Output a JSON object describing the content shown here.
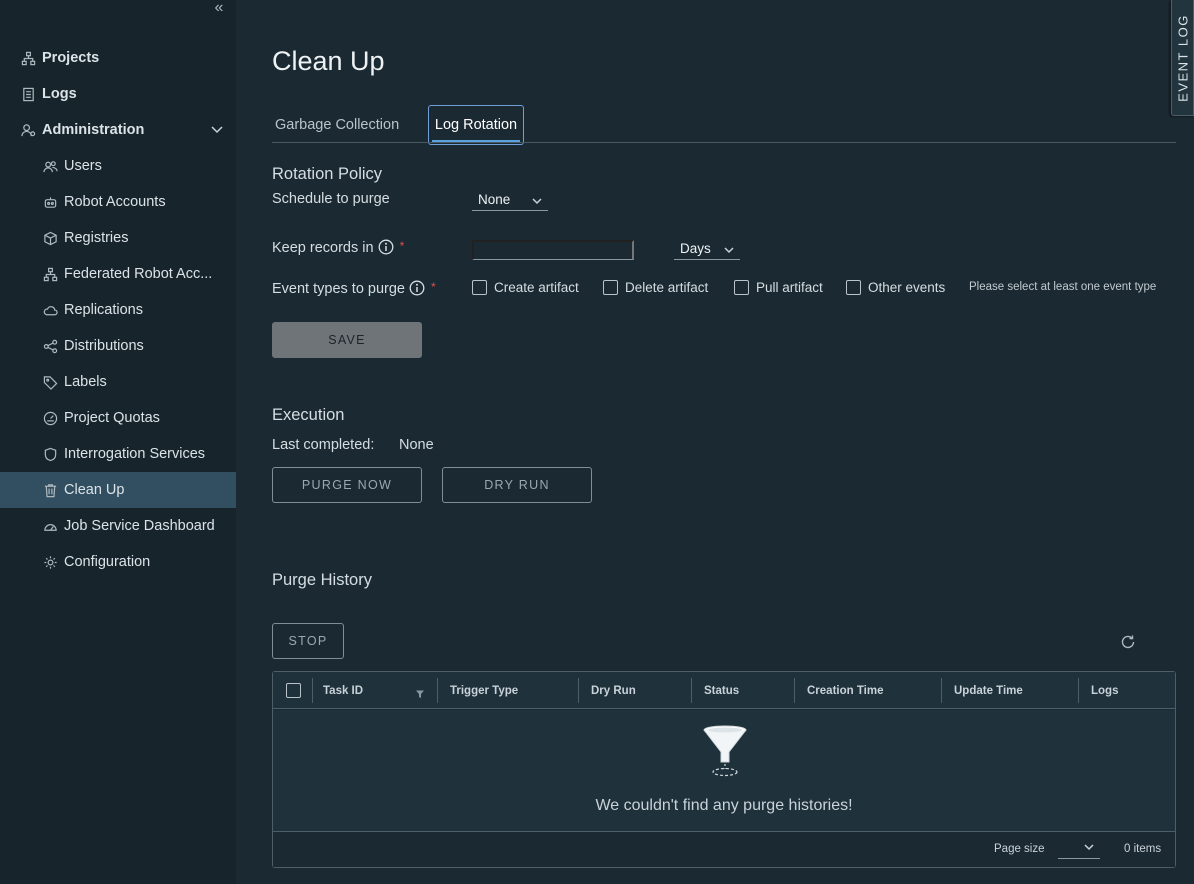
{
  "sidebar": {
    "items": [
      {
        "label": "Projects",
        "icon": "projects-icon"
      },
      {
        "label": "Logs",
        "icon": "logs-icon"
      },
      {
        "label": "Administration",
        "icon": "administration-icon"
      }
    ],
    "admin_items": [
      {
        "label": "Users",
        "icon": "users-icon"
      },
      {
        "label": "Robot Accounts",
        "icon": "robot-icon"
      },
      {
        "label": "Registries",
        "icon": "registries-icon"
      },
      {
        "label": "Federated Robot Acc...",
        "icon": "federated-icon"
      },
      {
        "label": "Replications",
        "icon": "replications-icon"
      },
      {
        "label": "Distributions",
        "icon": "distributions-icon"
      },
      {
        "label": "Labels",
        "icon": "labels-icon"
      },
      {
        "label": "Project Quotas",
        "icon": "quotas-icon"
      },
      {
        "label": "Interrogation Services",
        "icon": "shield-icon"
      },
      {
        "label": "Clean Up",
        "icon": "trash-icon"
      },
      {
        "label": "Job Service Dashboard",
        "icon": "dashboard-icon"
      },
      {
        "label": "Configuration",
        "icon": "gear-icon"
      }
    ]
  },
  "event_log": "EVENT LOG",
  "page": {
    "title": "Clean Up",
    "tabs": [
      "Garbage Collection",
      "Log Rotation"
    ]
  },
  "rotation": {
    "title": "Rotation Policy",
    "schedule_label": "Schedule to purge",
    "schedule_value": "None",
    "keep_label": "Keep records in",
    "keep_value": "",
    "keep_unit": "Days",
    "event_types_label": "Event types to purge",
    "required_mark": "*",
    "event_types": [
      "Create artifact",
      "Delete artifact",
      "Pull artifact",
      "Other events"
    ],
    "hint": "Please select at least one event type",
    "save": "SAVE"
  },
  "execution": {
    "title": "Execution",
    "last_completed_label": "Last completed:",
    "last_completed_value": "None",
    "purge_now": "PURGE NOW",
    "dry_run": "DRY RUN"
  },
  "history": {
    "title": "Purge History",
    "stop": "STOP",
    "columns": [
      "Task ID",
      "Trigger Type",
      "Dry Run",
      "Status",
      "Creation Time",
      "Update Time",
      "Logs"
    ],
    "empty": "We couldn't find any purge histories!",
    "page_size_label": "Page size",
    "items_count": "0 items"
  },
  "colors": {
    "background": "#1b2a32",
    "sidebar": "#17242b",
    "active_nav": "#324f61",
    "accent": "#5aa2e0",
    "required": "#e0504b"
  }
}
